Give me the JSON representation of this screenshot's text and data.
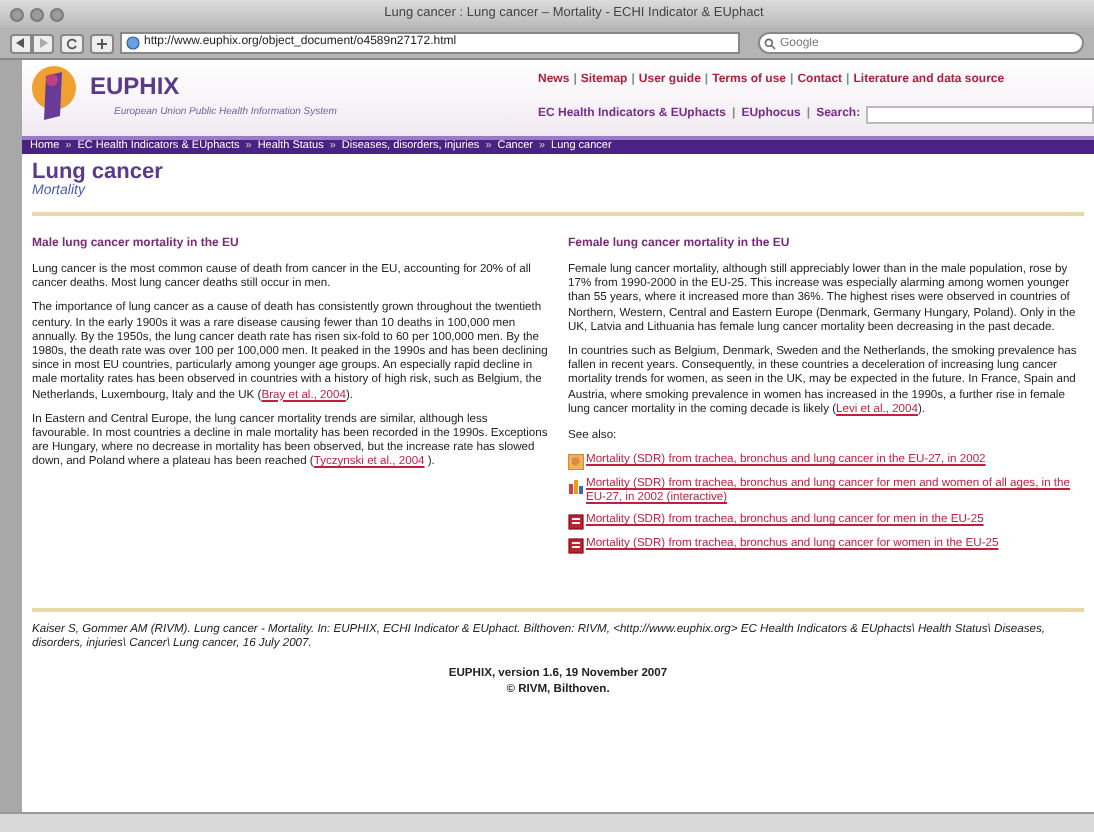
{
  "window": {
    "title": "Lung cancer : Lung cancer – Mortality - ECHI Indicator & EUphact"
  },
  "toolbar": {
    "url": "http://www.euphix.org/object_document/o4589n27172.html",
    "search_placeholder": "Google"
  },
  "header": {
    "logo_text": "EUPHIX",
    "tagline": "European Union Public Health Information System",
    "top_links": [
      "News",
      "Sitemap",
      "User guide",
      "Terms of use",
      "Contact",
      "Literature and data source"
    ],
    "nav_links": [
      "EC Health Indicators & EUphacts",
      "EUphocus"
    ],
    "search_label": "Search:",
    "separator": "|"
  },
  "breadcrumb": {
    "separator": "»",
    "items": [
      "Home",
      "EC Health Indicators & EUphacts",
      "Health Status",
      "Diseases, disorders, injuries",
      "Cancer",
      "Lung cancer"
    ]
  },
  "page": {
    "title": "Lung cancer",
    "subtitle": "Mortality"
  },
  "columns": [
    {
      "heading": "Male lung cancer mortality in the EU",
      "paragraphs": [
        {
          "text": "Lung cancer is the most common cause of death from cancer in the EU, accounting for 20% of all cancer deaths. Most lung cancer deaths still occur in men."
        },
        {
          "text": "The importance of lung cancer as a cause of death has consistently grown throughout the twentieth century. In the early 1900s it was a rare disease causing fewer than 10 deaths in 100,000 men annually. By the 1950s, the lung cancer death rate has risen six-fold to 60 per 100,000 men. By the 1980s, the death rate was over 100 per 100,000 men. It peaked in the 1990s and has been declining since in most EU countries, particularly among younger age groups. An especially rapid decline in male mortality rates has been observed in countries with a history of high risk, such as Belgium, the Netherlands, Luxembourg, Italy and the UK (",
          "link": "Bray et al., 2004",
          "after": ")."
        },
        {
          "text": "In Eastern and Central Europe, the lung cancer mortality trends are similar, although less favourable. In most countries a decline in male mortality has been recorded in the 1990s. Exceptions are Hungary, where no decrease in mortality has been observed, but the increase rate has slowed down, and Poland where a plateau has been reached (",
          "link": "Tyczynski et al., 2004",
          "after": " )."
        }
      ]
    },
    {
      "heading": "Female lung cancer mortality in the EU",
      "paragraphs": [
        {
          "text": "Female lung cancer mortality, although still appreciably lower than in the male population, rose by 17% from 1990-2000 in the EU-25. This increase was especially alarming among women younger than 55 years, where it increased more than 36%. The highest rises were observed in countries of Northern, Western, Central and Eastern Europe (Denmark, Germany Hungary, Poland). Only in the UK, Latvia and Lithuania has female lung cancer mortality been decreasing in the past decade."
        },
        {
          "text": "In countries such as Belgium, Denmark, Sweden and the Netherlands, the smoking prevalence has fallen in recent years. Consequently, in these countries a deceleration of increasing lung cancer mortality trends for women, as seen in the UK, may be expected in the future. In France, Spain and Austria, where smoking prevalence in women has increased in the 1990s, a further rise in female lung cancer mortality in the coming decade is likely (",
          "link": "Levi et al., 2004",
          "after": ")."
        }
      ]
    }
  ],
  "see_also": {
    "label": "See also:",
    "items": [
      {
        "kind": "map",
        "text": "Mortality (SDR) from trachea, bronchus and lung cancer in the EU-27, in 2002"
      },
      {
        "kind": "chart",
        "text": "Mortality (SDR) from trachea, bronchus and lung cancer for men and women of all ages, in the EU-27, in 2002 (interactive)"
      },
      {
        "kind": "report",
        "text": "Mortality (SDR) from trachea, bronchus and lung cancer for men in the EU-25"
      },
      {
        "kind": "report",
        "text": "Mortality (SDR) from trachea, bronchus and lung cancer for women in the EU-25"
      }
    ]
  },
  "citation": "Kaiser S, Gommer AM (RIVM). Lung cancer - Mortality. In: EUPHIX, ECHI Indicator & EUphact. Bilthoven: RIVM, <http://www.euphix.org> EC Health Indicators & EUphacts\\ Health Status\\ Diseases, disorders, injuries\\ Cancer\\ Lung cancer, 16 July 2007.",
  "version": [
    "EUPHIX, version 1.6, 19 November 2007",
    "© RIVM, Bilthoven."
  ]
}
